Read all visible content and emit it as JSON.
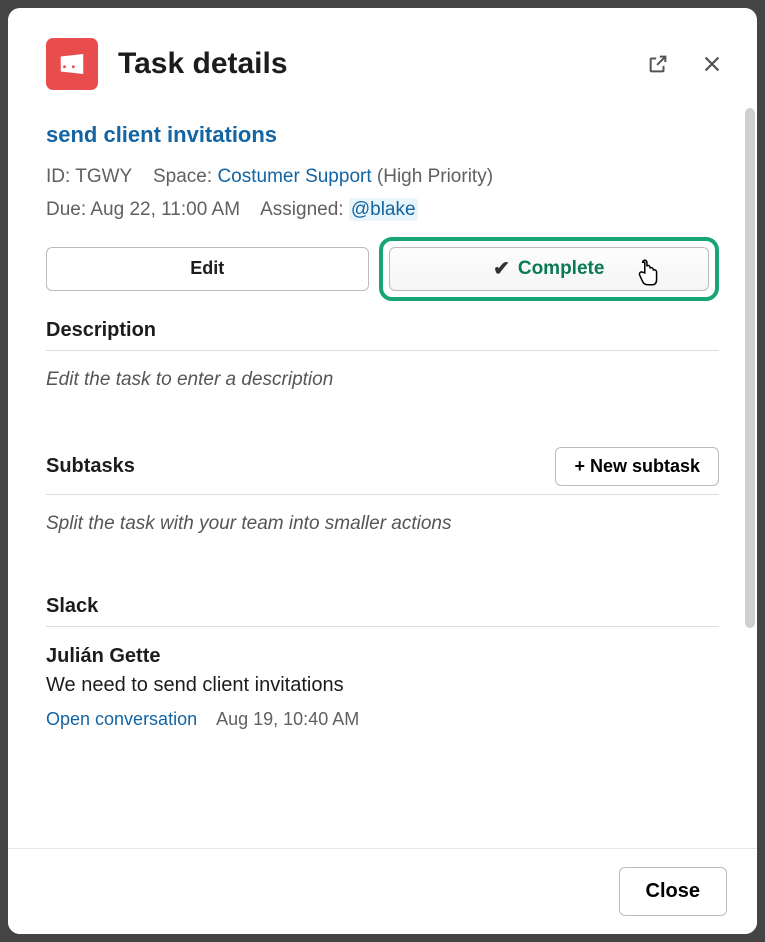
{
  "header": {
    "title": "Task details"
  },
  "task": {
    "title": "send client invitations",
    "id_label": "ID:",
    "id_value": "TGWY",
    "space_label": "Space:",
    "space_value": "Costumer Support",
    "priority": "(High Priority)",
    "due_label": "Due:",
    "due_value": "Aug 22, 11:00 AM",
    "assigned_label": "Assigned:",
    "assigned_value": "@blake"
  },
  "actions": {
    "edit": "Edit",
    "complete": "Complete"
  },
  "description": {
    "heading": "Description",
    "placeholder": "Edit the task to enter a description"
  },
  "subtasks": {
    "heading": "Subtasks",
    "new_button": "+ New subtask",
    "placeholder": "Split the task with your team into smaller actions"
  },
  "slack": {
    "heading": "Slack",
    "author": "Julián Gette",
    "message": "We need to send client invitations",
    "open_link": "Open conversation",
    "timestamp": "Aug 19, 10:40 AM"
  },
  "footer": {
    "close": "Close"
  }
}
